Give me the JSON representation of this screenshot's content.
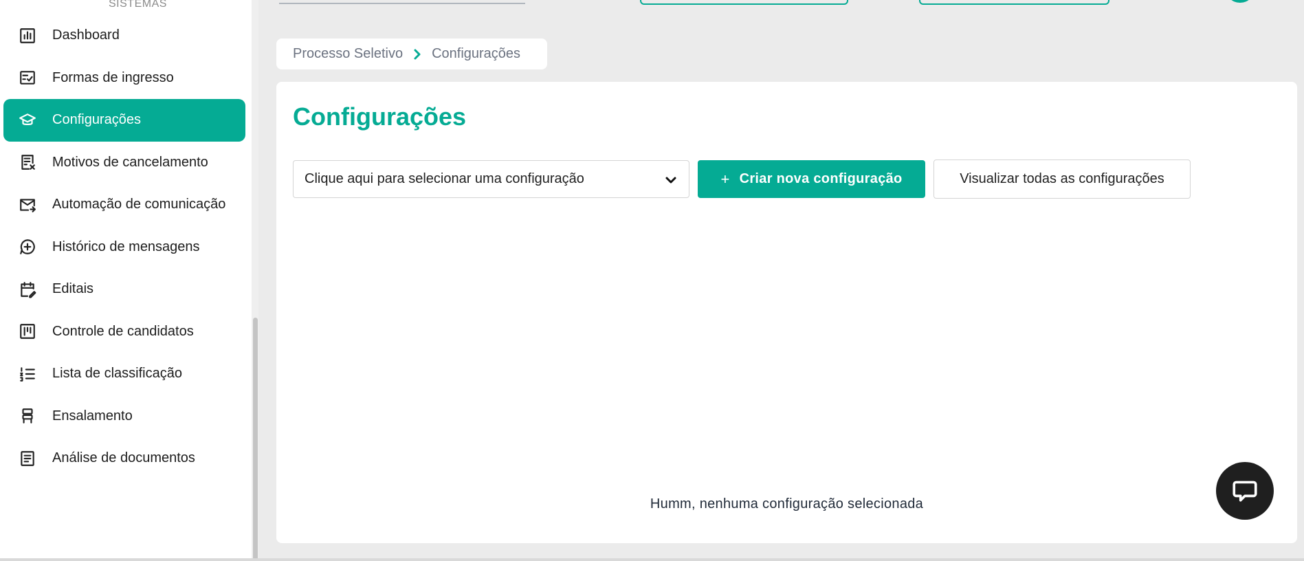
{
  "brand": {
    "text": "SISTEMAS"
  },
  "sidebar": {
    "items": [
      {
        "label": "Dashboard",
        "icon": "dashboard-chart-icon",
        "active": false
      },
      {
        "label": "Formas de ingresso",
        "icon": "checklist-icon",
        "active": false
      },
      {
        "label": "Configurações",
        "icon": "graduation-cap-icon",
        "active": true
      },
      {
        "label": "Motivos de cancelamento",
        "icon": "document-cancel-icon",
        "active": false
      },
      {
        "label": "Automação de comunicação",
        "icon": "mail-send-icon",
        "active": false
      },
      {
        "label": "Histórico de mensagens",
        "icon": "chat-plus-icon",
        "active": false
      },
      {
        "label": "Editais",
        "icon": "calendar-edit-icon",
        "active": false
      },
      {
        "label": "Controle de candidatos",
        "icon": "kanban-icon",
        "active": false
      },
      {
        "label": "Lista de classificação",
        "icon": "numbered-list-icon",
        "active": false
      },
      {
        "label": "Ensalamento",
        "icon": "seat-icon",
        "active": false
      },
      {
        "label": "Análise de documentos",
        "icon": "document-lines-icon",
        "active": false
      }
    ]
  },
  "breadcrumb": {
    "items": [
      "Processo Seletivo",
      "Configurações"
    ]
  },
  "main": {
    "title": "Configurações",
    "select_placeholder": "Clique aqui para selecionar uma configuração",
    "create_button": "Criar nova configuração",
    "create_button_icon": "+",
    "view_all_button": "Visualizar todas as configurações",
    "empty_message": "Humm, nenhuma configuração selecionada"
  },
  "colors": {
    "accent": "#05ab94",
    "background": "#ebebeb",
    "chat_button": "#1f1f1f"
  }
}
